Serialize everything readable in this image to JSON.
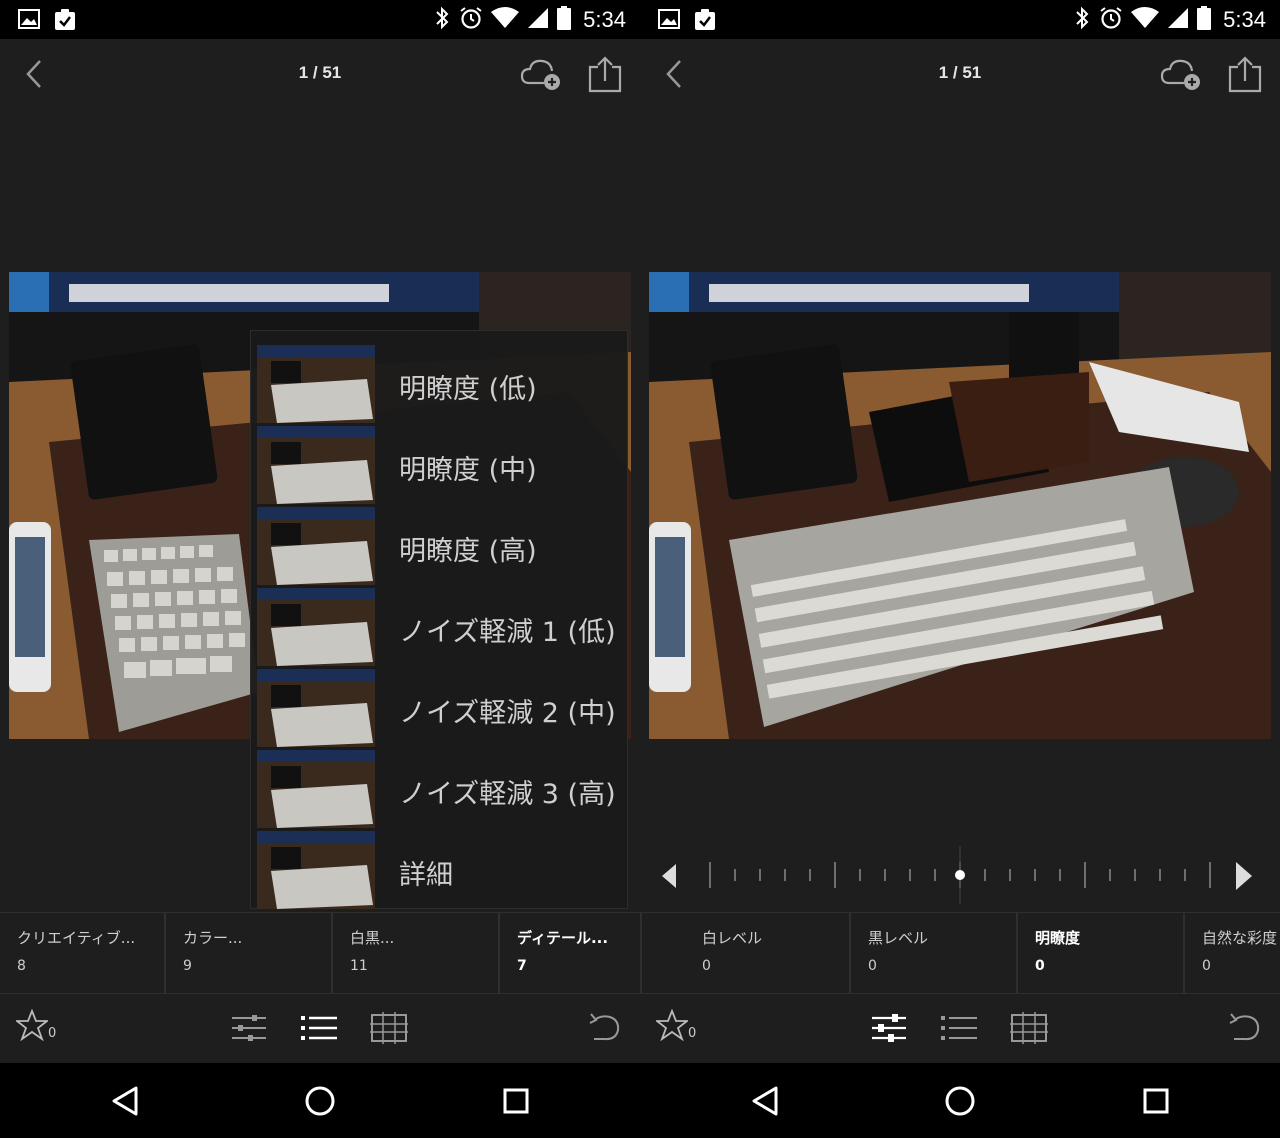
{
  "status_bar": {
    "time": "5:34"
  },
  "left": {
    "toolbar": {
      "counter": "1 / 51"
    },
    "menu": {
      "items": [
        {
          "label": "明瞭度 (低)"
        },
        {
          "label": "明瞭度 (中)"
        },
        {
          "label": "明瞭度 (高)"
        },
        {
          "label": "ノイズ軽減 1 (低)"
        },
        {
          "label": "ノイズ軽減 2 (中)"
        },
        {
          "label": "ノイズ軽減 3 (高)"
        },
        {
          "label": "詳細"
        }
      ]
    },
    "tabs": [
      {
        "name": "クリエイティブ...",
        "value": "8"
      },
      {
        "name": "カラー...",
        "value": "9"
      },
      {
        "name": "白黒...",
        "value": "11"
      },
      {
        "name": "ディテール...",
        "value": "7",
        "active": true
      }
    ],
    "bottom": {
      "rating": "0"
    }
  },
  "right": {
    "toolbar": {
      "counter": "1 / 51"
    },
    "tabs": [
      {
        "name": "白レベル",
        "value": "0"
      },
      {
        "name": "黒レベル",
        "value": "0"
      },
      {
        "name": "明瞭度",
        "value": "0",
        "active": true
      },
      {
        "name": "自然な彩度",
        "value": "0"
      }
    ],
    "slider": {
      "value": 0,
      "min": -100,
      "max": 100
    },
    "bottom": {
      "rating": "0"
    }
  },
  "icons": {
    "status_left": [
      "image-icon",
      "clipboard-check-icon"
    ],
    "status_right": [
      "bluetooth-icon",
      "alarm-icon",
      "wifi-icon",
      "signal-icon",
      "battery-icon"
    ]
  },
  "colors": {
    "background": "#1e1e1e",
    "active_text": "#ffffff",
    "inactive_text": "#cfcfcf"
  }
}
